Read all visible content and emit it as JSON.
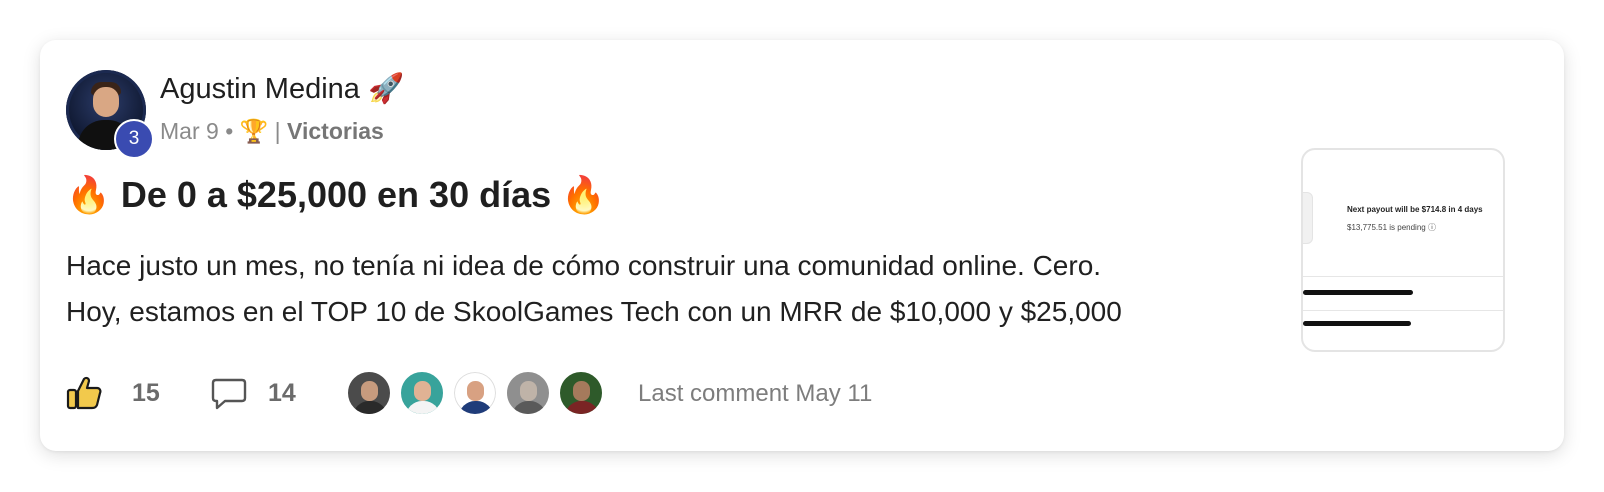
{
  "post": {
    "author": {
      "name": "Agustin Medina",
      "name_emoji": "🚀",
      "level": "3"
    },
    "meta": {
      "date": "Mar 9",
      "separator": "•",
      "category_emoji": "🏆",
      "divider": "|",
      "category": "Victorias"
    },
    "title": {
      "emoji": "🔥",
      "text": "De 0 a $25,000 en 30 días"
    },
    "body": [
      "Hace justo un mes, no tenía ni idea de cómo construir una comunidad online. Cero.",
      "Hoy, estamos en el TOP 10 de SkoolGames Tech con un MRR de $10,000 y $25,000"
    ],
    "thumbnail": {
      "payout_text": "Next payout will be $714.8 in 4 days",
      "pending_text": "$13,775.51 is pending ⓘ"
    },
    "actions": {
      "likes": "15",
      "comments": "14",
      "last_comment": "Last comment May 11"
    },
    "colors": {
      "level_badge": "#3a4bb1",
      "like_fill": "#f2c94c",
      "muted_text": "#8a8a8a"
    }
  }
}
